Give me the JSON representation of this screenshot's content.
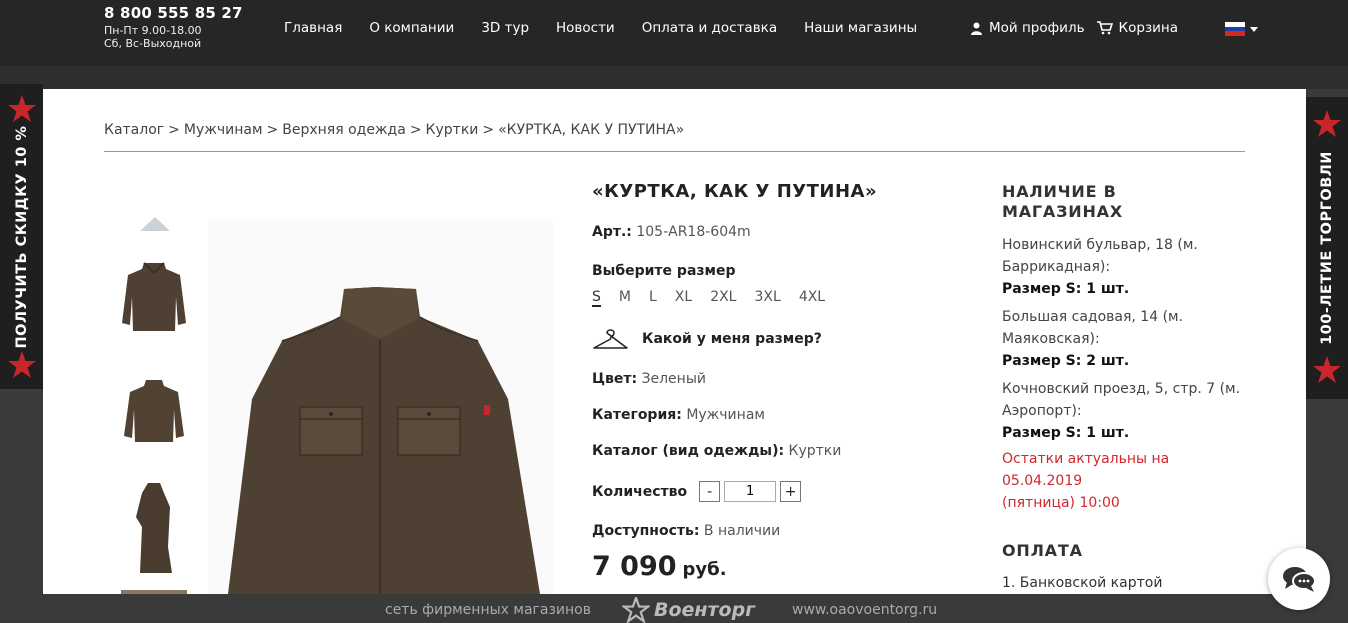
{
  "header": {
    "phone": "8 800 555 85 27",
    "hours_weekdays": "Пн-Пт 9.00-18.00",
    "hours_weekend": "Сб, Вс-Выходной",
    "nav": [
      "Главная",
      "О компании",
      "3D тур",
      "Новости",
      "Оплата и доставка",
      "Наши магазины"
    ],
    "profile_label": "Мой профиль",
    "cart_label": "Корзина",
    "language_flag": "russia-flag"
  },
  "side_tabs": {
    "left": "ПОЛУЧИТЬ СКИДКУ 10 %",
    "right": "100-ЛЕТИЕ ТОРГОВЛИ"
  },
  "breadcrumb": {
    "items": [
      "Каталог",
      "Мужчинам",
      "Верхняя одежда",
      "Куртки",
      "«КУРТКА, КАК У ПУТИНА»"
    ],
    "separator": ">"
  },
  "product": {
    "title": "«КУРТКА, КАК У ПУТИНА»",
    "sku_label": "Арт.:",
    "sku": "105-AR18-604m",
    "size_prompt": "Выберите размер",
    "sizes": [
      "S",
      "M",
      "L",
      "XL",
      "2XL",
      "3XL",
      "4XL"
    ],
    "selected_size": "S",
    "size_help": "Какой у меня размер?",
    "color_label": "Цвет:",
    "color": "Зеленый",
    "category_label": "Категория:",
    "category": "Мужчинам",
    "catalog_label": "Каталог (вид одежды):",
    "catalog": "Куртки",
    "quantity_label": "Количество",
    "quantity": "1",
    "qty_minus": "-",
    "qty_plus": "+",
    "availability_label": "Доступность:",
    "availability": "В наличии",
    "price": "7 090",
    "currency": "руб."
  },
  "stores": {
    "title_line1": "НАЛИЧИЕ В",
    "title_line2": "МАГАЗИНАХ",
    "list": [
      {
        "address": "Новинский бульвар, 18 (м. Баррикадная):",
        "stock": "Размер S: 1 шт."
      },
      {
        "address": "Большая садовая, 14 (м. Маяковская):",
        "stock": "Размер S: 2 шт."
      },
      {
        "address": "Кочновский проезд, 5, стр. 7 (м. Аэропорт):",
        "stock": "Размер S: 1 шт."
      }
    ],
    "note_line1": "Остатки актуальны на",
    "note_line2": "05.04.2019",
    "note_line3": "(пятница) 10:00"
  },
  "payment": {
    "title": "ОПЛАТА",
    "item1": "1. Банковской картой"
  },
  "footer": {
    "left": "сеть фирменных магазинов",
    "brand": "Военторг",
    "url": "www.oaovoentorg.ru"
  },
  "colors": {
    "header_bg": "#262626",
    "accent_red": "#d0282d",
    "jacket": "#4e4032"
  }
}
